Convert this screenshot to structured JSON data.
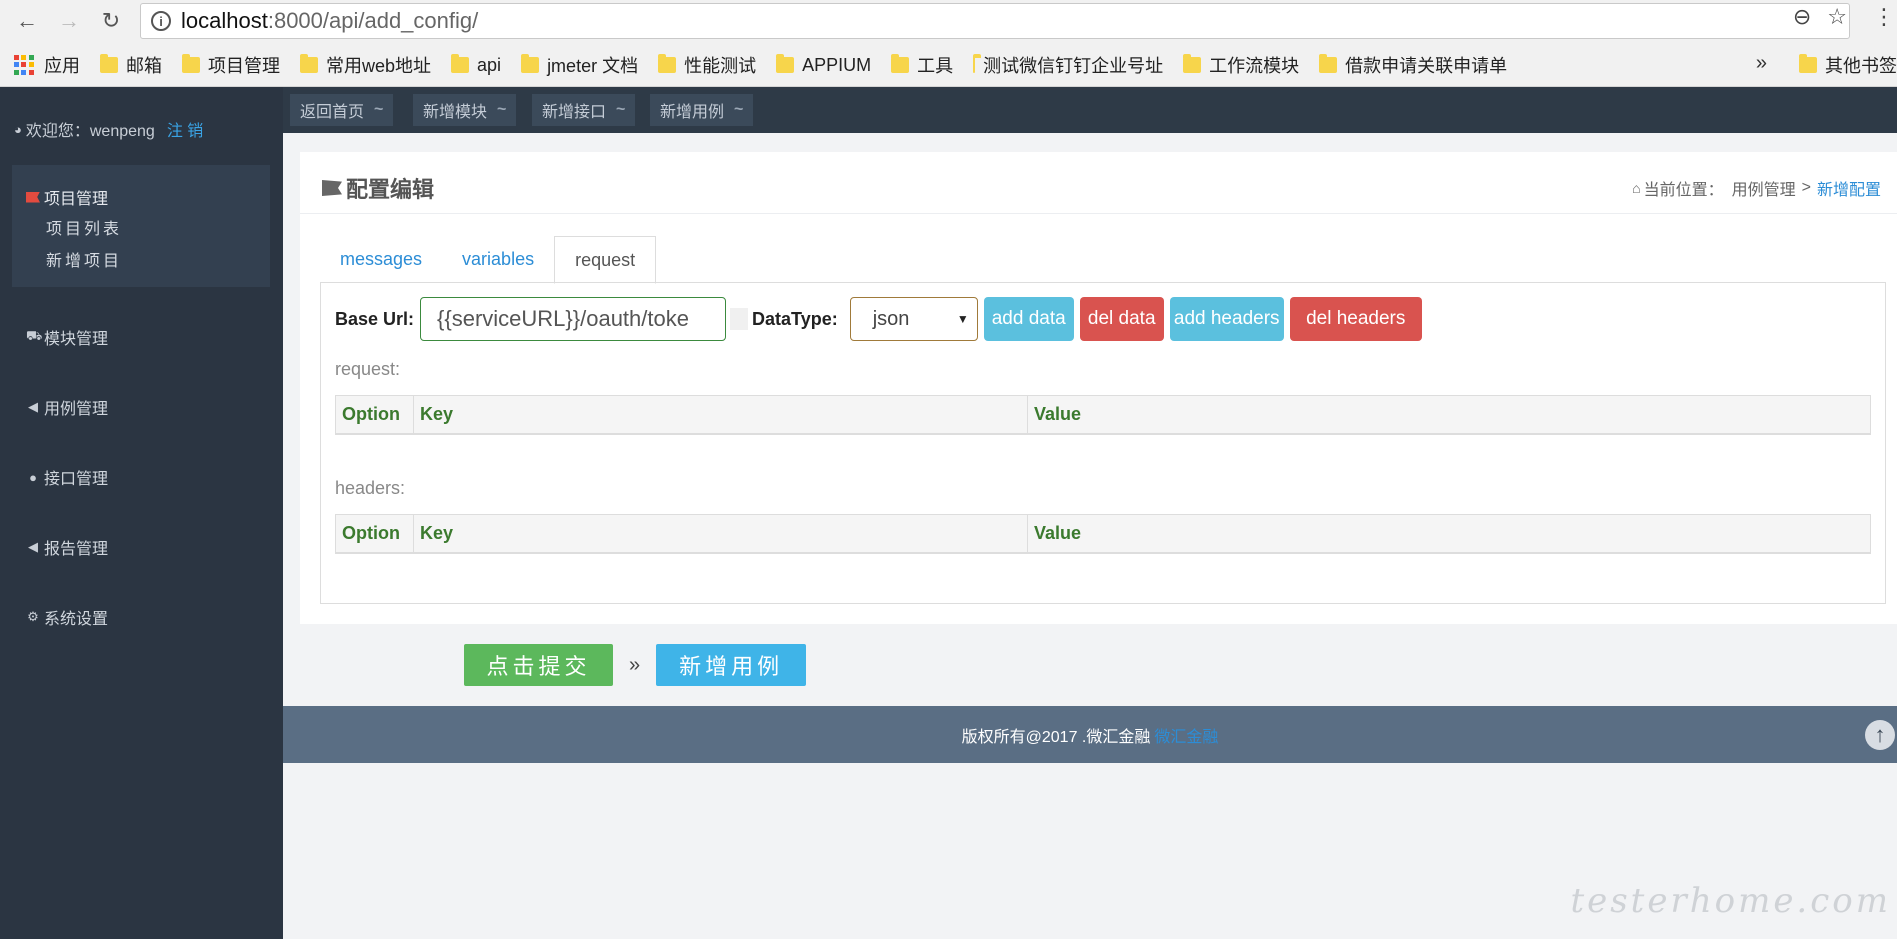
{
  "browser": {
    "url_host": "localhost",
    "url_path": ":8000/api/add_config/",
    "bookmarks": [
      {
        "label": "应用",
        "type": "apps"
      },
      {
        "label": "邮箱",
        "type": "folder"
      },
      {
        "label": "项目管理",
        "type": "folder"
      },
      {
        "label": "常用web地址",
        "type": "folder"
      },
      {
        "label": "api",
        "type": "folder"
      },
      {
        "label": "jmeter 文档",
        "type": "folder"
      },
      {
        "label": "性能测试",
        "type": "folder"
      },
      {
        "label": "APPIUM",
        "type": "folder"
      },
      {
        "label": "工具",
        "type": "folder"
      },
      {
        "label": "测试微信钉钉企业号址",
        "type": "folder"
      },
      {
        "label": "工作流模块",
        "type": "folder"
      },
      {
        "label": "借款申请关联申请单",
        "type": "folder"
      }
    ],
    "more": "»",
    "other_bookmarks": "其他书签"
  },
  "sidebar": {
    "welcome": "欢迎您：wenpeng",
    "logout": "注 销",
    "project_mgmt": "项目管理",
    "project_list": "项目列表",
    "new_project": "新增项目",
    "module_mgmt": "模块管理",
    "case_mgmt": "用例管理",
    "api_mgmt": "接口管理",
    "report_mgmt": "报告管理",
    "system_settings": "系统设置"
  },
  "topbar": {
    "home": "返回首页",
    "add_module": "新增模块",
    "add_api": "新增接口",
    "add_case": "新增用例",
    "tilde": "~"
  },
  "panel": {
    "title": "配置编辑",
    "crumb_prefix": "当前位置：",
    "crumb_parent": "用例管理",
    "crumb_sep": ">",
    "crumb_current": "新增配置",
    "tabs": [
      "messages",
      "variables",
      "request"
    ],
    "active_tab": "request",
    "base_url_label": "Base Url:",
    "base_url_value": "{{serviceURL}}/oauth/toke",
    "datatype_label": "DataType:",
    "datatype_value": "json",
    "buttons": {
      "add_data": "add data",
      "del_data": "del data",
      "add_headers": "add headers",
      "del_headers": "del headers"
    },
    "request_label": "request:",
    "headers_label": "headers:",
    "columns": [
      "Option",
      "Key",
      "Value"
    ]
  },
  "actions": {
    "submit": "点击提交",
    "raquo": "»",
    "new_case": "新增用例"
  },
  "footer": {
    "copyright": "版权所有@2017 .微汇金融",
    "link": "微汇金融"
  },
  "watermark": "testerhome.com",
  "colors": {
    "sidebar_bg": "#2b3542",
    "accent_blue": "#2c8dd6",
    "success": "#5cb85c",
    "info": "#5bc0de",
    "danger": "#d9534f",
    "footer_bg": "#5a6e84"
  }
}
